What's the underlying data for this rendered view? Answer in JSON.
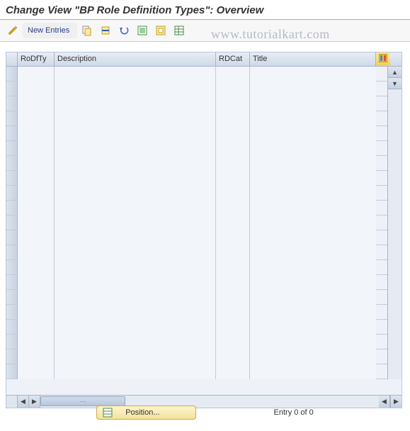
{
  "title": "Change View \"BP Role Definition Types\": Overview",
  "watermark": "www.tutorialkart.com",
  "toolbar": {
    "new_entries_label": "New Entries"
  },
  "columns": {
    "rodfty": "RoDfTy",
    "description": "Description",
    "rdcat": "RDCat",
    "title": "Title"
  },
  "rows": [
    {
      "rodfty": "",
      "description": "",
      "rdcat": "",
      "title": ""
    },
    {
      "rodfty": "",
      "description": "",
      "rdcat": "",
      "title": ""
    },
    {
      "rodfty": "",
      "description": "",
      "rdcat": "",
      "title": ""
    },
    {
      "rodfty": "",
      "description": "",
      "rdcat": "",
      "title": ""
    },
    {
      "rodfty": "",
      "description": "",
      "rdcat": "",
      "title": ""
    },
    {
      "rodfty": "",
      "description": "",
      "rdcat": "",
      "title": ""
    },
    {
      "rodfty": "",
      "description": "",
      "rdcat": "",
      "title": ""
    },
    {
      "rodfty": "",
      "description": "",
      "rdcat": "",
      "title": ""
    },
    {
      "rodfty": "",
      "description": "",
      "rdcat": "",
      "title": ""
    },
    {
      "rodfty": "",
      "description": "",
      "rdcat": "",
      "title": ""
    },
    {
      "rodfty": "",
      "description": "",
      "rdcat": "",
      "title": ""
    },
    {
      "rodfty": "",
      "description": "",
      "rdcat": "",
      "title": ""
    },
    {
      "rodfty": "",
      "description": "",
      "rdcat": "",
      "title": ""
    },
    {
      "rodfty": "",
      "description": "",
      "rdcat": "",
      "title": ""
    },
    {
      "rodfty": "",
      "description": "",
      "rdcat": "",
      "title": ""
    },
    {
      "rodfty": "",
      "description": "",
      "rdcat": "",
      "title": ""
    },
    {
      "rodfty": "",
      "description": "",
      "rdcat": "",
      "title": ""
    },
    {
      "rodfty": "",
      "description": "",
      "rdcat": "",
      "title": ""
    },
    {
      "rodfty": "",
      "description": "",
      "rdcat": "",
      "title": ""
    },
    {
      "rodfty": "",
      "description": "",
      "rdcat": "",
      "title": ""
    },
    {
      "rodfty": "",
      "description": "",
      "rdcat": "",
      "title": ""
    }
  ],
  "footer": {
    "position_label": "Position...",
    "entry_status": "Entry 0 of 0"
  }
}
